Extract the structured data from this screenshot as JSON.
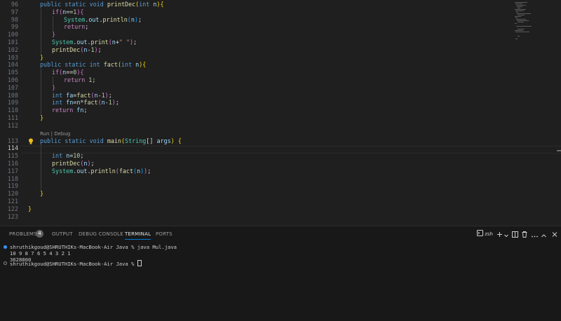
{
  "editor": {
    "codelens": "Run | Debug",
    "lines": [
      {
        "n": "96",
        "toks": [
          [
            "kw",
            "public "
          ],
          [
            "kw",
            "static "
          ],
          [
            "kw",
            "void "
          ],
          [
            "fn",
            "printDec"
          ],
          [
            "br1",
            "("
          ],
          [
            "kw",
            "int "
          ],
          [
            "vr",
            "n"
          ],
          [
            "br1",
            ")"
          ],
          [
            "br1",
            "{"
          ]
        ]
      },
      {
        "n": "97",
        "toks": [
          [
            "ctl",
            "if"
          ],
          [
            "br2",
            "("
          ],
          [
            "vr",
            "n"
          ],
          [
            "pl",
            "=="
          ],
          [
            "nm",
            "1"
          ],
          [
            "br2",
            ")"
          ],
          [
            "br2",
            "{"
          ]
        ]
      },
      {
        "n": "98",
        "toks": [
          [
            "tp",
            "System"
          ],
          [
            "pl",
            "."
          ],
          [
            "vr",
            "out"
          ],
          [
            "pl",
            "."
          ],
          [
            "fn",
            "println"
          ],
          [
            "br3",
            "("
          ],
          [
            "vr",
            "n"
          ],
          [
            "br3",
            ")"
          ],
          [
            "pl",
            ";"
          ]
        ]
      },
      {
        "n": "99",
        "toks": [
          [
            "ctl",
            "return"
          ],
          [
            "pl",
            ";"
          ]
        ]
      },
      {
        "n": "100",
        "toks": [
          [
            "br2",
            "}"
          ]
        ]
      },
      {
        "n": "101",
        "toks": [
          [
            "tp",
            "System"
          ],
          [
            "pl",
            "."
          ],
          [
            "vr",
            "out"
          ],
          [
            "pl",
            "."
          ],
          [
            "fn",
            "print"
          ],
          [
            "br2",
            "("
          ],
          [
            "vr",
            "n"
          ],
          [
            "pl",
            "+"
          ],
          [
            "st",
            "\" \""
          ],
          [
            "br2",
            ")"
          ],
          [
            "pl",
            ";"
          ]
        ]
      },
      {
        "n": "102",
        "toks": [
          [
            "fn",
            "printDec"
          ],
          [
            "br2",
            "("
          ],
          [
            "vr",
            "n"
          ],
          [
            "pl",
            "-"
          ],
          [
            "nm",
            "1"
          ],
          [
            "br2",
            ")"
          ],
          [
            "pl",
            ";"
          ]
        ]
      },
      {
        "n": "103",
        "toks": [
          [
            "br1",
            "}"
          ]
        ]
      },
      {
        "n": "104",
        "toks": [
          [
            "kw",
            "public "
          ],
          [
            "kw",
            "static "
          ],
          [
            "kw",
            "int "
          ],
          [
            "fn",
            "fact"
          ],
          [
            "br1",
            "("
          ],
          [
            "kw",
            "int "
          ],
          [
            "vr",
            "n"
          ],
          [
            "br1",
            ")"
          ],
          [
            "br1",
            "{"
          ]
        ]
      },
      {
        "n": "105",
        "toks": [
          [
            "ctl",
            "if"
          ],
          [
            "br2",
            "("
          ],
          [
            "vr",
            "n"
          ],
          [
            "pl",
            "=="
          ],
          [
            "nm",
            "0"
          ],
          [
            "br2",
            ")"
          ],
          [
            "br2",
            "{"
          ]
        ]
      },
      {
        "n": "106",
        "toks": [
          [
            "ctl",
            "return "
          ],
          [
            "nm",
            "1"
          ],
          [
            "pl",
            ";"
          ]
        ]
      },
      {
        "n": "107",
        "toks": [
          [
            "br2",
            "}"
          ]
        ]
      },
      {
        "n": "108",
        "toks": [
          [
            "kw",
            "int "
          ],
          [
            "vr",
            "fa"
          ],
          [
            "pl",
            "="
          ],
          [
            "fn",
            "fact"
          ],
          [
            "br2",
            "("
          ],
          [
            "vr",
            "n"
          ],
          [
            "pl",
            "-"
          ],
          [
            "nm",
            "1"
          ],
          [
            "br2",
            ")"
          ],
          [
            "pl",
            ";"
          ]
        ]
      },
      {
        "n": "109",
        "toks": [
          [
            "kw",
            "int "
          ],
          [
            "vr",
            "fn"
          ],
          [
            "pl",
            "="
          ],
          [
            "vr",
            "n"
          ],
          [
            "pl",
            "*"
          ],
          [
            "fn",
            "fact"
          ],
          [
            "br2",
            "("
          ],
          [
            "vr",
            "n"
          ],
          [
            "pl",
            "-"
          ],
          [
            "nm",
            "1"
          ],
          [
            "br2",
            ")"
          ],
          [
            "pl",
            ";"
          ]
        ]
      },
      {
        "n": "110",
        "toks": [
          [
            "ctl",
            "return "
          ],
          [
            "vr",
            "fn"
          ],
          [
            "pl",
            ";"
          ]
        ]
      },
      {
        "n": "111",
        "toks": [
          [
            "br1",
            "}"
          ]
        ]
      },
      {
        "n": "112",
        "toks": []
      },
      {
        "n": "113",
        "toks": [
          [
            "kw",
            "public "
          ],
          [
            "kw",
            "static "
          ],
          [
            "kw",
            "void "
          ],
          [
            "fn",
            "main"
          ],
          [
            "br1",
            "("
          ],
          [
            "tp",
            "String"
          ],
          [
            "pl",
            "[] "
          ],
          [
            "vr",
            "args"
          ],
          [
            "br1",
            ")"
          ],
          [
            "pl",
            " "
          ],
          [
            "br1",
            "{"
          ]
        ]
      },
      {
        "n": "114",
        "toks": []
      },
      {
        "n": "115",
        "toks": [
          [
            "kw",
            "int "
          ],
          [
            "vr",
            "n"
          ],
          [
            "pl",
            "="
          ],
          [
            "nm",
            "10"
          ],
          [
            "pl",
            ";"
          ]
        ]
      },
      {
        "n": "116",
        "toks": [
          [
            "fn",
            "printDec"
          ],
          [
            "br2",
            "("
          ],
          [
            "vr",
            "n"
          ],
          [
            "br2",
            ")"
          ],
          [
            "pl",
            ";"
          ]
        ]
      },
      {
        "n": "117",
        "toks": [
          [
            "tp",
            "System"
          ],
          [
            "pl",
            "."
          ],
          [
            "vr",
            "out"
          ],
          [
            "pl",
            "."
          ],
          [
            "fn",
            "println"
          ],
          [
            "br2",
            "("
          ],
          [
            "fn",
            "fact"
          ],
          [
            "br3",
            "("
          ],
          [
            "vr",
            "n"
          ],
          [
            "br3",
            ")"
          ],
          [
            "br2",
            ")"
          ],
          [
            "pl",
            ";"
          ]
        ]
      },
      {
        "n": "118",
        "toks": []
      },
      {
        "n": "119",
        "toks": []
      },
      {
        "n": "120",
        "toks": [
          [
            "br1",
            "}"
          ]
        ]
      },
      {
        "n": "121",
        "toks": []
      },
      {
        "n": "122",
        "toks": [
          [
            "br1",
            "}"
          ]
        ]
      },
      {
        "n": "123",
        "toks": []
      }
    ]
  },
  "panel": {
    "tabs": {
      "problems": "PROBLEMS",
      "output": "OUTPUT",
      "debug_console": "DEBUG CONSOLE",
      "terminal": "TERMINAL",
      "ports": "PORTS"
    },
    "problems_count": "4",
    "shell": "zsh",
    "icons": {
      "shell": "terminal-icon",
      "add": "plus-icon",
      "split": "split-icon",
      "trash": "trash-icon",
      "more": "ellipsis-icon",
      "maximize": "chevron-up-icon",
      "close": "close-icon"
    },
    "terminal": {
      "cmd": "shruthikgoud@SHRUTHIKs-MacBook-Air Java % java Mul.java",
      "out1": "10 9 8 7 6 5 4 3 2 1",
      "out2": "3628800",
      "prompt": "shruthikgoud@SHRUTHIKs-MacBook-Air Java % "
    }
  },
  "colors": {
    "accent": "#0078d4",
    "background": "#1f1f1f"
  }
}
